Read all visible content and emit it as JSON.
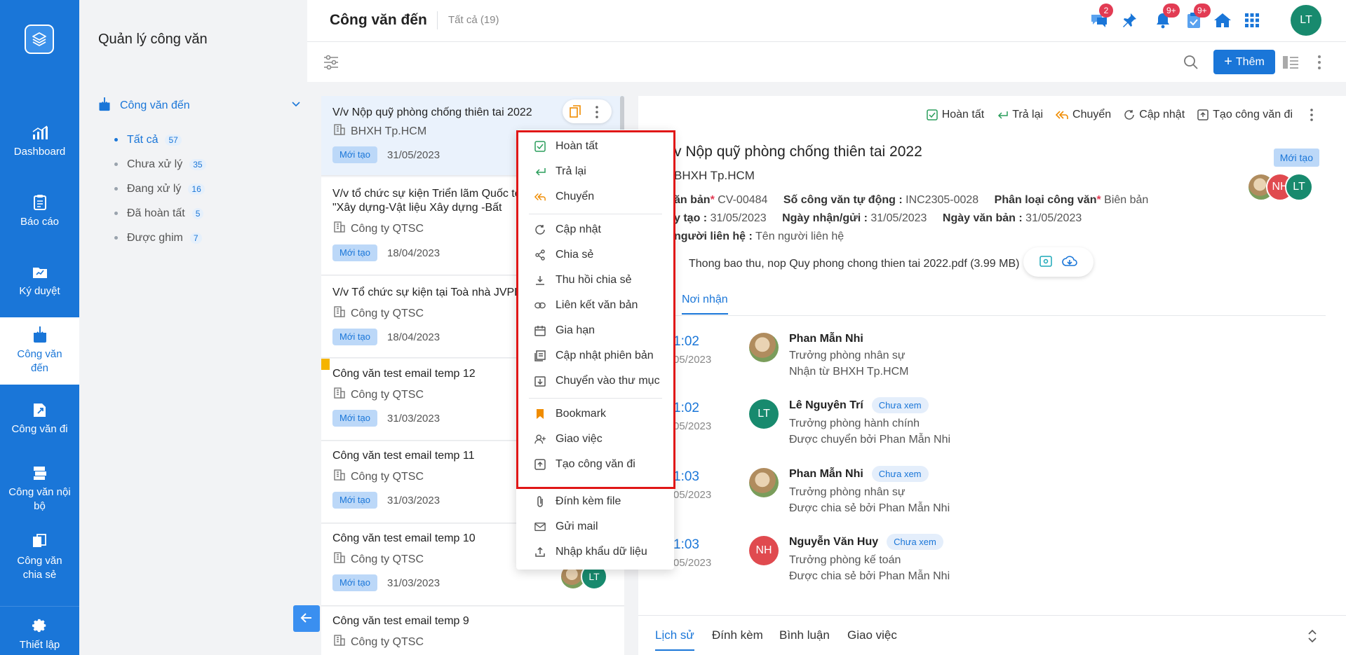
{
  "rail": {
    "items": [
      {
        "label": "Dashboard",
        "icon": "chart-icon"
      },
      {
        "label": "Báo cáo",
        "icon": "report-icon"
      },
      {
        "label": "Ký duyệt",
        "icon": "sign-icon"
      },
      {
        "label": "Công văn đến",
        "icon": "incoming-doc-icon"
      },
      {
        "label": "Công văn đi",
        "icon": "outgoing-doc-icon"
      },
      {
        "label": "Công văn nội bộ",
        "icon": "internal-doc-icon"
      },
      {
        "label": "Công văn chia sẻ",
        "icon": "shared-doc-icon"
      },
      {
        "label": "Thiết lập",
        "icon": "gear-icon"
      }
    ]
  },
  "sidebar": {
    "title": "Quản lý công văn",
    "section": "Công văn đến",
    "items": [
      {
        "label": "Tất cả",
        "count": "57"
      },
      {
        "label": "Chưa xử lý",
        "count": "35"
      },
      {
        "label": "Đang xử lý",
        "count": "16"
      },
      {
        "label": "Đã hoàn tất",
        "count": "5"
      },
      {
        "label": "Được ghim",
        "count": "7"
      }
    ]
  },
  "header": {
    "title": "Công văn đến",
    "crumb": "Tất cả (19)",
    "badges": {
      "chat": "2",
      "bell": "9+",
      "tasks": "9+"
    },
    "avatar": "LT",
    "add_label": "Thêm"
  },
  "list": [
    {
      "title": "V/v Nộp quỹ phòng chống thiên tai 2022",
      "org": "BHXH Tp.HCM",
      "status": "Mới tạo",
      "date": "31/05/2023"
    },
    {
      "title": "V/v tổ chức sự kiện Triển lãm Quốc tế \"Xây dựng-Vật liệu Xây dựng -Bất động",
      "org": "Công ty QTSC",
      "status": "Mới tạo",
      "date": "18/04/2023"
    },
    {
      "title": "V/v Tổ chức sự kiện tại Toà nhà JVPE",
      "org": "Công ty QTSC",
      "status": "Mới tạo",
      "date": "18/04/2023"
    },
    {
      "title": "Công văn test email temp 12",
      "org": "Công ty QTSC",
      "status": "Mới tạo",
      "date": "31/03/2023"
    },
    {
      "title": "Công văn test email temp 11",
      "org": "Công ty QTSC",
      "status": "Mới tạo",
      "date": "31/03/2023"
    },
    {
      "title": "Công văn test email temp 10",
      "org": "Công ty QTSC",
      "status": "Mới tạo",
      "date": "31/03/2023"
    },
    {
      "title": "Công văn test email temp 9",
      "org": "Công ty QTSC"
    }
  ],
  "list_avatar": "LT",
  "menu": [
    {
      "label": "Hoàn tất",
      "icon": "check-square-icon"
    },
    {
      "label": "Trả lại",
      "icon": "return-icon"
    },
    {
      "label": "Chuyển",
      "icon": "forward-icon"
    },
    {
      "label": "Cập nhật",
      "icon": "refresh-icon"
    },
    {
      "label": "Chia sẻ",
      "icon": "share-icon"
    },
    {
      "label": "Thu hồi chia sẻ",
      "icon": "revoke-icon"
    },
    {
      "label": "Liên kết văn bản",
      "icon": "link-icon"
    },
    {
      "label": "Gia hạn",
      "icon": "calendar-icon"
    },
    {
      "label": "Cập nhật phiên bản",
      "icon": "version-icon"
    },
    {
      "label": "Chuyển vào thư mục",
      "icon": "folder-move-icon"
    },
    {
      "label": "Bookmark",
      "icon": "bookmark-icon"
    },
    {
      "label": "Giao việc",
      "icon": "assign-user-icon"
    },
    {
      "label": "Tạo công văn đi",
      "icon": "create-outgoing-icon"
    },
    {
      "label": "Đính kèm file",
      "icon": "paperclip-icon"
    },
    {
      "label": "Gửi mail",
      "icon": "mail-icon"
    },
    {
      "label": "Nhập khẩu dữ liệu",
      "icon": "import-icon"
    }
  ],
  "detail": {
    "actions": [
      "Hoàn tất",
      "Trả lại",
      "Chuyển",
      "Cập nhật",
      "Tạo công văn đi"
    ],
    "title": "v Nộp quỹ phòng chống thiên tai 2022",
    "org": "BHXH Tp.HCM",
    "status": "Mới tạo",
    "avatars": [
      "NH",
      "LT"
    ],
    "fields_row1": {
      "l1": "ăn bản",
      "v1": "CV-00484",
      "l2": "Số công văn tự động :",
      "v2": "INC2305-0028",
      "l3": "Phân loại công văn",
      "v3": "Biên bản"
    },
    "fields_row2": {
      "l1": "y tạo :",
      "v1": "31/05/2023",
      "l2": "Ngày nhận/gửi :",
      "v2": "31/05/2023",
      "l3": "Ngày văn bản :",
      "v3": "31/05/2023"
    },
    "fields_row3": {
      "l1": "người liên hệ :",
      "v1": "Tên người liên hệ"
    },
    "attachment": "Thong bao thu, nop Quy phong chong thien tai 2022.pdf (3.99 MB)",
    "tab": "Nơi nhận",
    "receivers": [
      {
        "time": "1:02",
        "date": "05/2023",
        "name": "Phan Mẫn Nhi",
        "badge": "",
        "role": "Trưởng phòng nhân sự",
        "note": "Nhận từ BHXH Tp.HCM",
        "av": "img"
      },
      {
        "time": "1:02",
        "date": "05/2023",
        "name": "Lê Nguyên Trí",
        "badge": "Chưa xem",
        "role": "Trưởng phòng hành chính",
        "note": "Được chuyển bởi Phan Mẫn Nhi",
        "av": "LT"
      },
      {
        "time": "1:03",
        "date": "05/2023",
        "name": "Phan Mẫn Nhi",
        "badge": "Chưa xem",
        "role": "Trưởng phòng nhân sự",
        "note": "Được chia sẻ bởi Phan Mẫn Nhi",
        "av": "img"
      },
      {
        "time": "1:03",
        "date": "05/2023",
        "name": "Nguyễn Văn Huy",
        "badge": "Chưa xem",
        "role": "Trưởng phòng kế toán",
        "note": "Được chia sẻ bởi Phan Mẫn Nhi",
        "av": "NH"
      }
    ],
    "bottom_tabs": [
      "Lịch sử",
      "Đính kèm",
      "Bình luận",
      "Giao việc"
    ]
  },
  "colors": {
    "primary": "#1a76d8",
    "badge": "#e23b53",
    "highlight": "#e01717"
  }
}
